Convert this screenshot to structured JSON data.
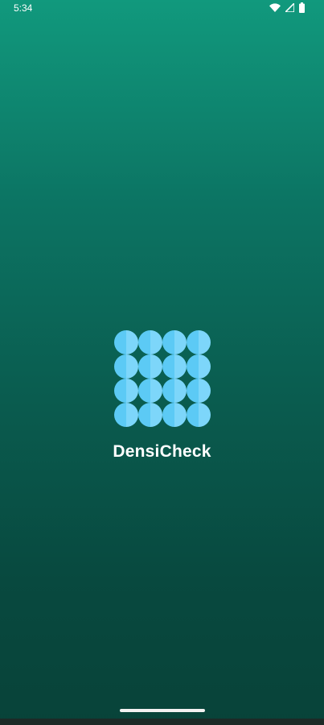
{
  "status_bar": {
    "time": "5:34",
    "icons": [
      "wifi-icon",
      "signal-icon",
      "battery-icon"
    ]
  },
  "splash": {
    "logo_icon": "dot-grid-logo-icon",
    "app_name": "DensiCheck"
  },
  "colors": {
    "background_top": "#11997d",
    "background_bottom": "#084339",
    "logo_dot_left": "#5ccaf5",
    "logo_dot_right": "#7dd6fa",
    "text": "#ffffff"
  }
}
